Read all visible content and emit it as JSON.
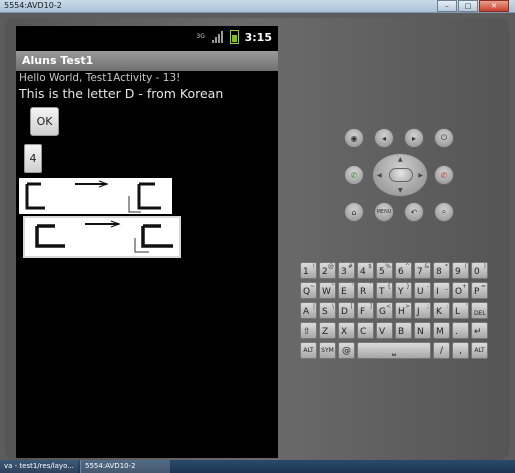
{
  "window": {
    "title": "5554:AVD10-2",
    "controls": [
      "–",
      "□",
      "✕"
    ]
  },
  "status_bar": {
    "network": "3G",
    "time": "3:15"
  },
  "app": {
    "title": "Aluns Test1",
    "hello_text": "Hello World, Test1Activity - 13!",
    "letter_text": "This is the letter D - from Korean",
    "ok_button": "OK",
    "number_button": "4"
  },
  "keyboard": {
    "row1": [
      {
        "k": "1",
        "a": "!"
      },
      {
        "k": "2",
        "a": "@"
      },
      {
        "k": "3",
        "a": "#"
      },
      {
        "k": "4",
        "a": "$"
      },
      {
        "k": "5",
        "a": "%"
      },
      {
        "k": "6",
        "a": "^"
      },
      {
        "k": "7",
        "a": "&"
      },
      {
        "k": "8",
        "a": "*"
      },
      {
        "k": "9",
        "a": "("
      },
      {
        "k": "0",
        "a": ")"
      }
    ],
    "row2": [
      {
        "k": "Q",
        "a": "~"
      },
      {
        "k": "W",
        "a": "\""
      },
      {
        "k": "E",
        "a": "'"
      },
      {
        "k": "R",
        "a": "`"
      },
      {
        "k": "T",
        "a": "{"
      },
      {
        "k": "Y",
        "a": "}"
      },
      {
        "k": "U",
        "a": "-"
      },
      {
        "k": "I",
        "a": "_"
      },
      {
        "k": "O",
        "a": "+"
      },
      {
        "k": "P",
        "a": "="
      }
    ],
    "row3": [
      {
        "k": "A",
        "a": "|"
      },
      {
        "k": "S",
        "a": "\\"
      },
      {
        "k": "D",
        "a": "["
      },
      {
        "k": "F",
        "a": "]"
      },
      {
        "k": "G",
        "a": "<"
      },
      {
        "k": "H",
        "a": ">"
      },
      {
        "k": "J",
        "a": ";"
      },
      {
        "k": "K",
        "a": ":"
      },
      {
        "k": "L",
        "a": "'"
      },
      {
        "k": "DEL",
        "a": ""
      }
    ],
    "row4": [
      {
        "k": "⇧",
        "a": ""
      },
      {
        "k": "Z",
        "a": ""
      },
      {
        "k": "X",
        "a": ""
      },
      {
        "k": "C",
        "a": ""
      },
      {
        "k": "V",
        "a": ""
      },
      {
        "k": "B",
        "a": ""
      },
      {
        "k": "N",
        "a": ""
      },
      {
        "k": "M",
        "a": ""
      },
      {
        "k": ".",
        "a": ""
      },
      {
        "k": "↵",
        "a": ""
      }
    ],
    "row5": {
      "alt_left": "ALT",
      "sym": "SYM",
      "at": "@",
      "space": "⎵",
      "slash": "/",
      "comma": ",",
      "alt_right": "ALT"
    }
  },
  "taskbar": {
    "item1": "va - test1/res/layo...",
    "item2": "5554:AVD10-2"
  }
}
